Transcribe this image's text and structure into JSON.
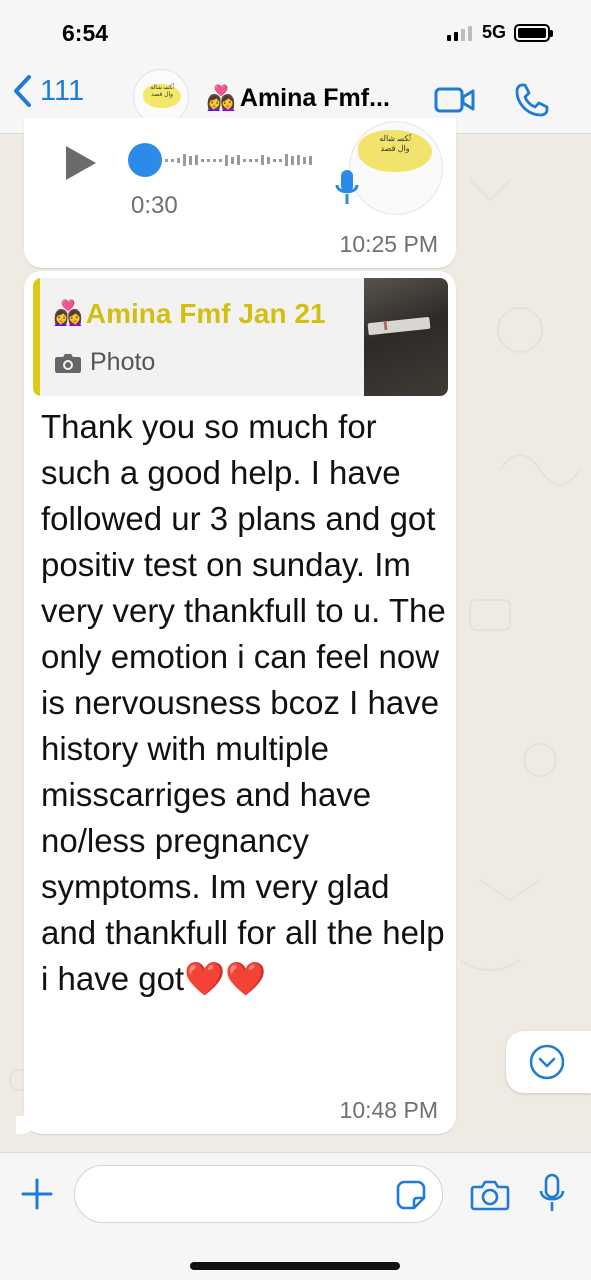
{
  "status_bar": {
    "time": "6:54",
    "network": "5G",
    "battery_level": 1.0
  },
  "header": {
    "back_count": "111",
    "contact_emoji": "👩‍❤️‍👩",
    "contact_name": "Amina Fmf..."
  },
  "voice_message": {
    "duration": "0:30",
    "time": "10:25 PM",
    "playback_progress": 0.0
  },
  "text_message": {
    "quote": {
      "emoji": "👩‍❤️‍👩",
      "name": "Amina Fmf Jan 21",
      "type_label": "Photo"
    },
    "body": "Thank you so much for such a good help. I have followed ur 3 plans and got positiv test on sunday. Im very very thankfull to u. The only emotion i can feel now is nervousness bcoz I have history with multiple misscarriges and have no/less pregnancy symptoms. Im very glad and thankfull for all the help i have got❤️❤️",
    "time": "10:48 PM"
  },
  "colors": {
    "accent": "#1f7ad8",
    "quote_bar": "#dccb16",
    "quote_name": "#d1c012",
    "chat_background": "#efeae2",
    "bubble": "#ffffff"
  },
  "icons": {
    "back": "chevron-left-icon",
    "video": "video-camera-icon",
    "call": "phone-icon",
    "play": "play-icon",
    "mic": "microphone-icon",
    "camera": "camera-icon",
    "plus": "plus-icon",
    "sticker": "sticker-icon",
    "scroll": "chevron-down-circle-icon"
  }
}
